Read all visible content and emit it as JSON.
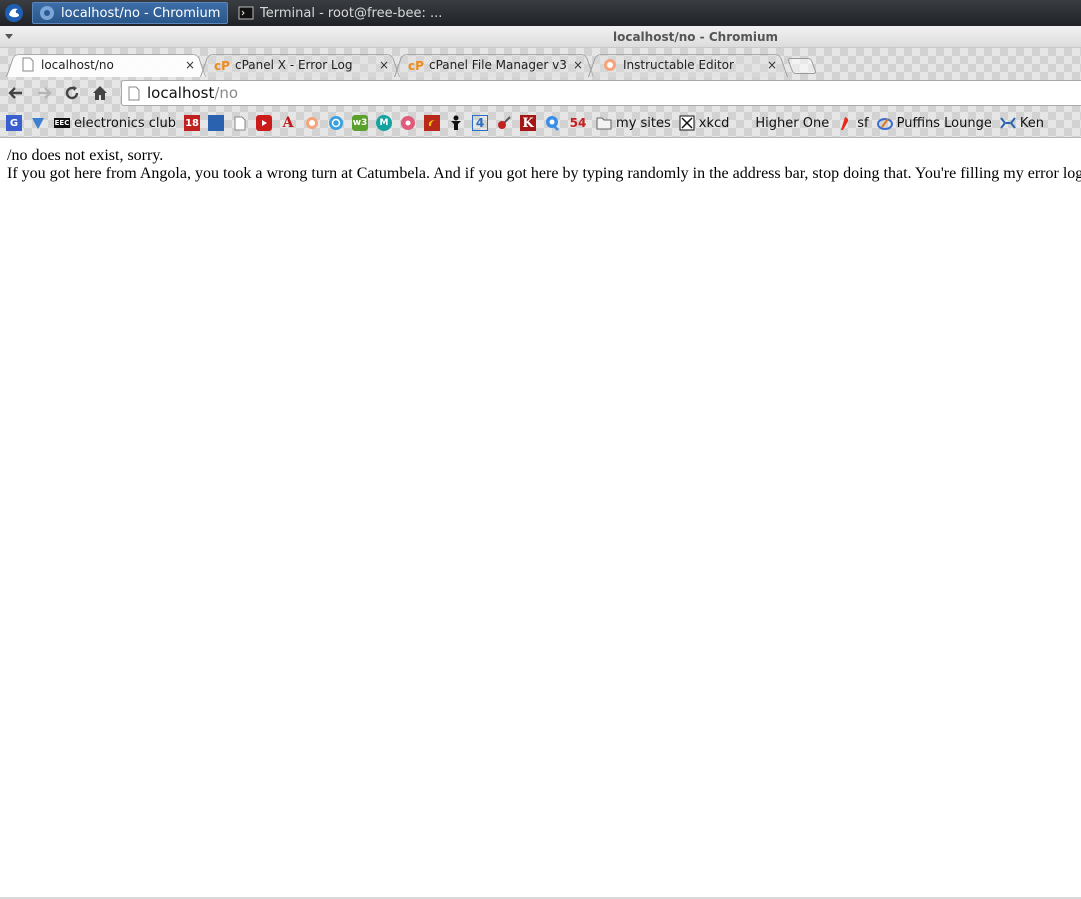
{
  "taskbar": {
    "items": [
      {
        "label": "localhost/no - Chromium",
        "active": true
      },
      {
        "label": "Terminal - root@free-bee: ...",
        "active": false
      }
    ]
  },
  "window": {
    "title": "localhost/no - Chromium"
  },
  "tabs": [
    {
      "label": "localhost/no",
      "close": "×"
    },
    {
      "label": "cPanel X - Error Log",
      "close": "×"
    },
    {
      "label": "cPanel File Manager v3",
      "close": "×"
    },
    {
      "label": "Instructable Editor",
      "close": "×"
    }
  ],
  "omnibox": {
    "host": "localhost",
    "path": "/no"
  },
  "bookmarks": [
    {
      "label": "electronics club",
      "icon": "eec-icon"
    },
    {
      "label": "my sites",
      "icon": "folder-icon"
    },
    {
      "label": "xkcd",
      "icon": "xkcd-icon"
    },
    {
      "label": "Higher One",
      "icon": "blank-icon"
    },
    {
      "label": "sf",
      "icon": "sf-icon"
    },
    {
      "label": "Puffins Lounge",
      "icon": "puffin-icon"
    },
    {
      "label": "Ken",
      "icon": "ken-icon"
    }
  ],
  "bookmark_text_icons": {
    "b18": "18",
    "b4": "4",
    "bk": "K",
    "b54": "54",
    "ba": "A"
  },
  "colors": {
    "accent": "#2a568a",
    "page_bg": "#ffffff",
    "taskbar_bg": "#202226"
  },
  "page": {
    "line1": "/no does not exist, sorry.",
    "line2": "If you got here from Angola, you took a wrong turn at Catumbela. And if you got here by typing randomly in the address bar, stop doing that. You're filling my error logs with unreadable garbage."
  }
}
